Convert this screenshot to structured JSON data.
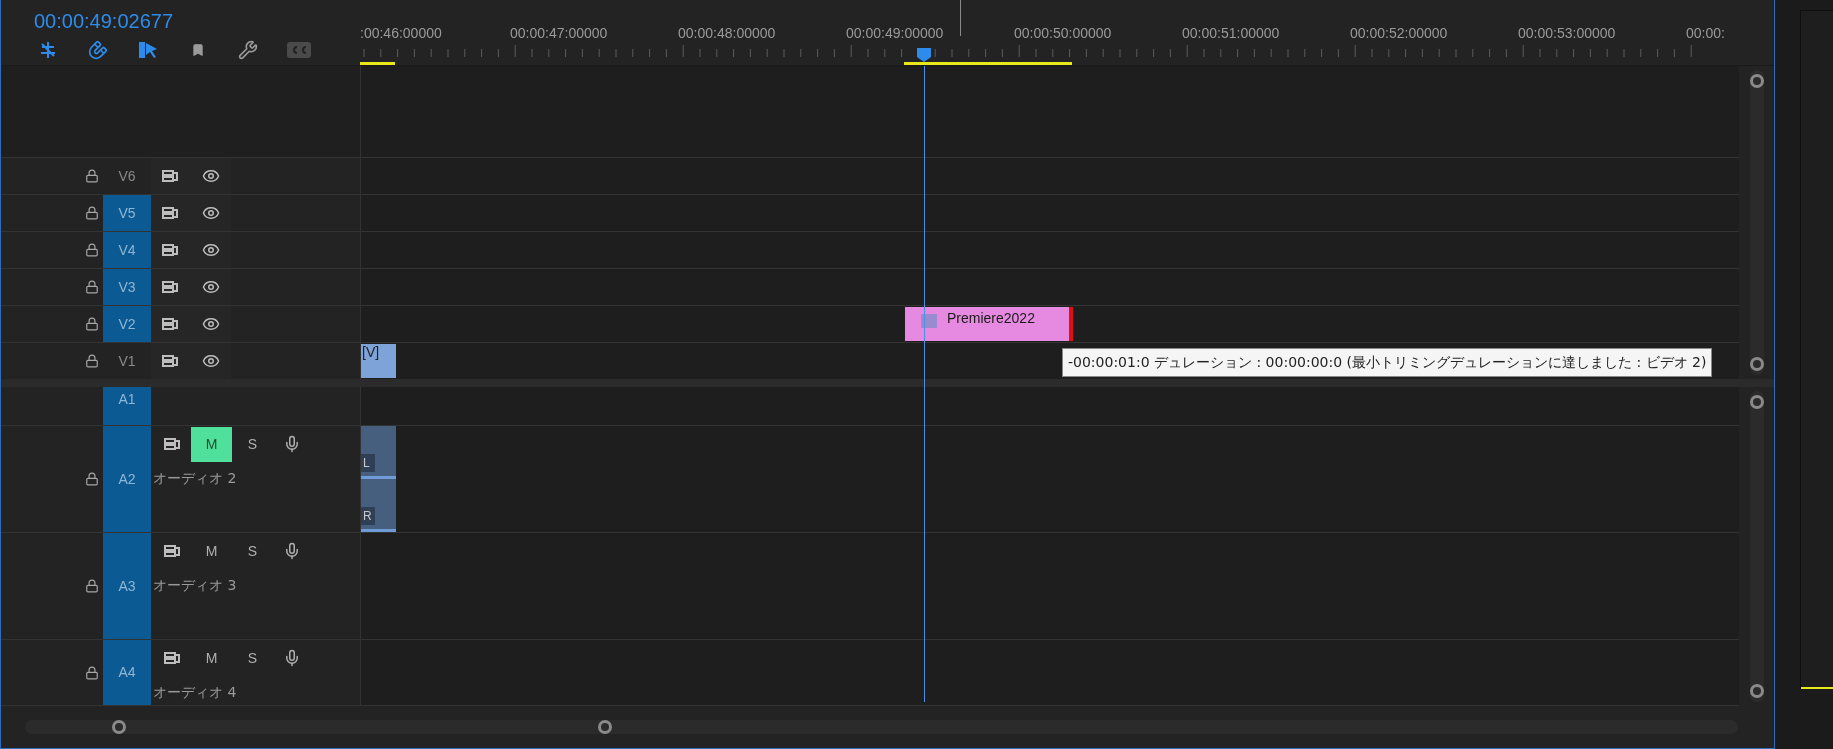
{
  "timecode": "00:00:49:02677",
  "toolbar": [
    {
      "kind": "snap",
      "on": true
    },
    {
      "kind": "magnet",
      "on": true
    },
    {
      "kind": "linked",
      "on": true
    },
    {
      "kind": "marker",
      "on": false
    },
    {
      "kind": "wrench",
      "on": false
    },
    {
      "kind": "captions",
      "on": false
    }
  ],
  "ruler": {
    "labels": [
      ":00:46:00000",
      "00:00:47:00000",
      "00:00:48:00000",
      "00:00:49:00000",
      "00:00:50:00000",
      "00:00:51:00000",
      "00:00:52:00000",
      "00:00:53:00000",
      "00:00:"
    ]
  },
  "video_tracks": [
    {
      "label": "V6",
      "targeted": false
    },
    {
      "label": "V5",
      "targeted": true
    },
    {
      "label": "V4",
      "targeted": true
    },
    {
      "label": "V3",
      "targeted": true
    },
    {
      "label": "V2",
      "targeted": true,
      "clip": {
        "kind": "pink",
        "label": "Premiere2022",
        "fx": true
      }
    },
    {
      "label": "V1",
      "targeted": false,
      "clip": {
        "kind": "blue",
        "label": "[V]",
        "fx": false
      }
    }
  ],
  "audio_tracks": [
    {
      "label": "A1",
      "targeted": true,
      "collapsed": true
    },
    {
      "label": "A2",
      "targeted": true,
      "collapsed": false,
      "name": "オーディオ 2",
      "mute": "M",
      "muted": true,
      "solo": "S",
      "clip": {
        "channels": [
          "L",
          "R"
        ]
      }
    },
    {
      "label": "A3",
      "targeted": true,
      "collapsed": false,
      "name": "オーディオ 3",
      "mute": "M",
      "muted": false,
      "solo": "S"
    },
    {
      "label": "A4",
      "targeted": true,
      "collapsed": false,
      "name": "オーディオ 4",
      "mute": "M",
      "muted": false,
      "solo": "S"
    }
  ],
  "tooltip": "-00:00:01:0 デュレーション : 00:00:00:0 (最小トリミングデュレーションに達しました : ビデオ 2)"
}
